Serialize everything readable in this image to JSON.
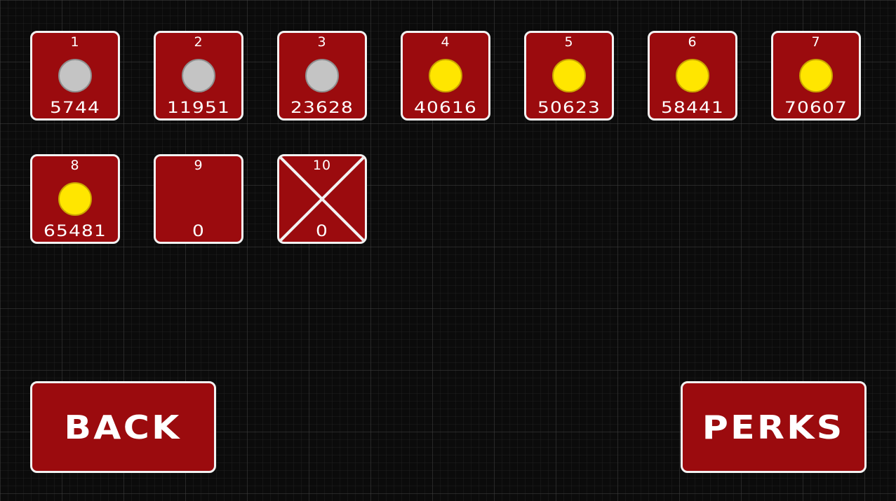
{
  "levels": [
    {
      "number": "1",
      "score": "5744",
      "medal": "silver"
    },
    {
      "number": "2",
      "score": "11951",
      "medal": "silver"
    },
    {
      "number": "3",
      "score": "23628",
      "medal": "silver"
    },
    {
      "number": "4",
      "score": "40616",
      "medal": "gold"
    },
    {
      "number": "5",
      "score": "50623",
      "medal": "gold"
    },
    {
      "number": "6",
      "score": "58441",
      "medal": "gold"
    },
    {
      "number": "7",
      "score": "70607",
      "medal": "gold"
    },
    {
      "number": "8",
      "score": "65481",
      "medal": "gold"
    },
    {
      "number": "9",
      "score": "0",
      "medal": "none"
    },
    {
      "number": "10",
      "score": "0",
      "medal": "locked"
    }
  ],
  "buttons": {
    "back_label": "BACK",
    "perks_label": "PERKS"
  },
  "colors": {
    "tile_fill": "#9b0b0e",
    "tile_border": "#f2f2f2",
    "gold_medal": "#ffe600",
    "silver_medal": "#c4c4c4",
    "background": "#0b0b0b"
  }
}
